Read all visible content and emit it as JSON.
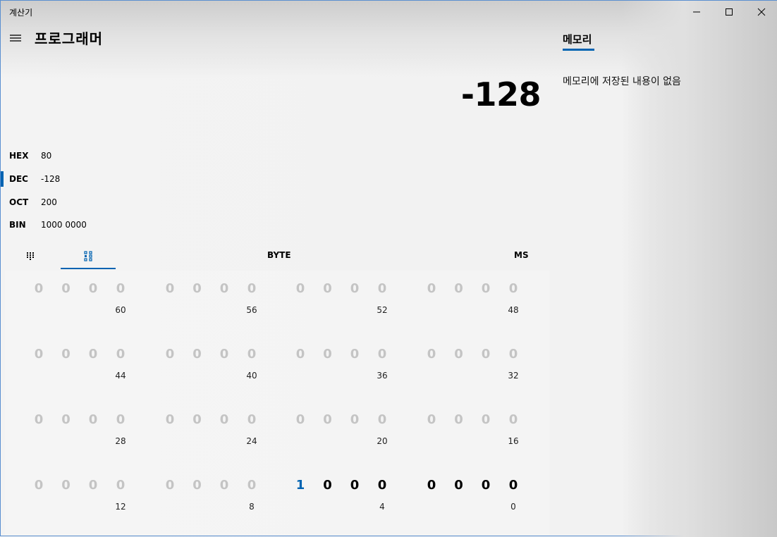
{
  "window": {
    "title": "계산기"
  },
  "header": {
    "mode_title": "프로그래머"
  },
  "display": {
    "value": "-128"
  },
  "radix": [
    {
      "label": "HEX",
      "value": "80",
      "selected": false
    },
    {
      "label": "DEC",
      "value": "-128",
      "selected": true
    },
    {
      "label": "OCT",
      "value": "200",
      "selected": false
    },
    {
      "label": "BIN",
      "value": "1000 0000",
      "selected": false
    }
  ],
  "toolbar": {
    "word_size": "BYTE",
    "memory_store": "MS"
  },
  "bits": {
    "rows": [
      {
        "values": [
          "0",
          "0",
          "0",
          "0",
          "0",
          "0",
          "0",
          "0",
          "0",
          "0",
          "0",
          "0",
          "0",
          "0",
          "0",
          "0"
        ],
        "labels": [
          "60",
          "56",
          "52",
          "48"
        ]
      },
      {
        "values": [
          "0",
          "0",
          "0",
          "0",
          "0",
          "0",
          "0",
          "0",
          "0",
          "0",
          "0",
          "0",
          "0",
          "0",
          "0",
          "0"
        ],
        "labels": [
          "44",
          "40",
          "36",
          "32"
        ]
      },
      {
        "values": [
          "0",
          "0",
          "0",
          "0",
          "0",
          "0",
          "0",
          "0",
          "0",
          "0",
          "0",
          "0",
          "0",
          "0",
          "0",
          "0"
        ],
        "labels": [
          "28",
          "24",
          "20",
          "16"
        ]
      },
      {
        "values": [
          "0",
          "0",
          "0",
          "0",
          "0",
          "0",
          "0",
          "0",
          "1",
          "0",
          "0",
          "0",
          "0",
          "0",
          "0",
          "0"
        ],
        "labels": [
          "12",
          "8",
          "4",
          "0"
        ]
      }
    ],
    "active_bits_from": 8,
    "lead_color": "#0063b1"
  },
  "memory": {
    "tab_label": "메모리",
    "empty_message": "메모리에 저장된 내용이 없음"
  },
  "colors": {
    "accent": "#0063b1",
    "inactive_bit": "#c4c4c4"
  }
}
